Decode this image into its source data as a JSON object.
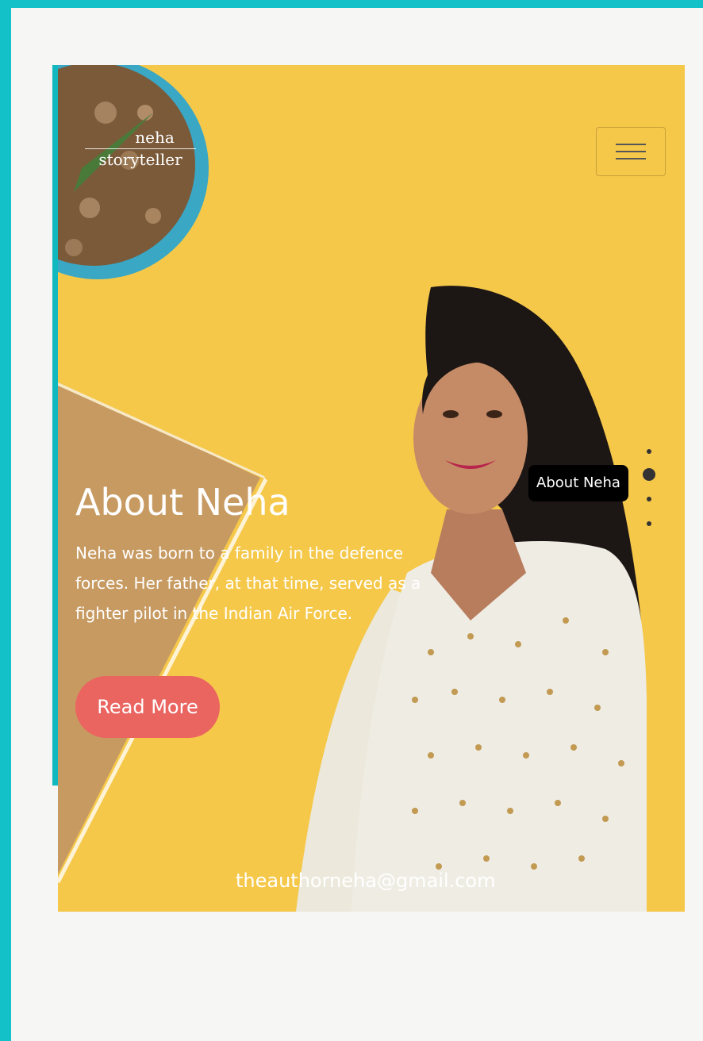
{
  "brand": {
    "line1": "neha",
    "line2": "storyteller"
  },
  "nav": {
    "menu_icon": "hamburger-icon"
  },
  "hero": {
    "title": "About Neha",
    "description": "Neha was born to a family in the defence forces. Her father, at that time, served as a fighter pilot in the Indian Air Force.",
    "read_more_label": "Read More",
    "email": "theauthorneha@gmail.com"
  },
  "section_nav": {
    "tooltip": "About Neha",
    "dots": [
      "section-1",
      "about-neha",
      "section-3",
      "section-4"
    ],
    "active_index": 1
  },
  "colors": {
    "frame": "#12c2c8",
    "hero_background": "#f5c84a",
    "button": "#ea6460",
    "page": "#f6f6f4"
  }
}
